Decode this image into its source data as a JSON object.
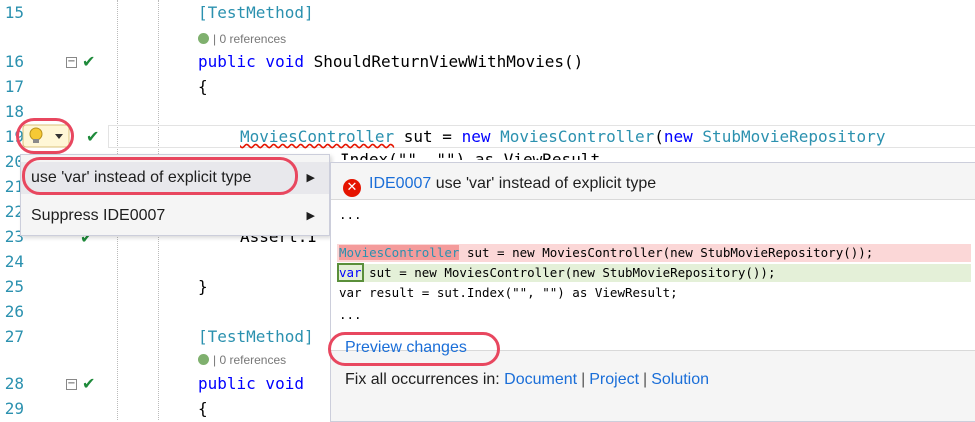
{
  "editor": {
    "lines": [
      {
        "num": "15",
        "text": "[TestMethod]"
      },
      {
        "num": "16",
        "text": "public void ShouldReturnViewWithMovies()"
      },
      {
        "num": "17",
        "text": "{"
      },
      {
        "num": "18",
        "text": ""
      },
      {
        "num": "19",
        "text": "MoviesController sut = new MoviesController(new StubMovieRepository"
      },
      {
        "num": "20",
        "text": ""
      },
      {
        "num": "21",
        "text": ""
      },
      {
        "num": "22",
        "text": ""
      },
      {
        "num": "23",
        "text": "Assert.I"
      },
      {
        "num": "24",
        "text": ""
      },
      {
        "num": "25",
        "text": "}"
      },
      {
        "num": "26",
        "text": ""
      },
      {
        "num": "27",
        "text": "[TestMethod]"
      },
      {
        "num": "28",
        "text": "public void"
      },
      {
        "num": "29",
        "text": "{"
      }
    ],
    "codelens_1": "| 0 references",
    "codelens_2": "| 0 references",
    "partial_line_20": "Index(\"\", \"\") as ViewResult"
  },
  "quick_actions_menu": {
    "items": [
      {
        "label": "use 'var' instead of explicit type",
        "has_submenu": true,
        "selected": true
      },
      {
        "label": "Suppress IDE0007",
        "has_submenu": true,
        "selected": false
      }
    ]
  },
  "preview": {
    "diagnostic_id": "IDE0007",
    "diagnostic_message": "use 'var' instead of explicit type",
    "ellipsis_top": "...",
    "removed_token": "MoviesController",
    "removed_rest": " sut = new MoviesController(new StubMovieRepository());",
    "added_token": "var",
    "added_rest": " sut = new MoviesController(new StubMovieRepository());",
    "context_line": "var result = sut.Index(\"\", \"\") as ViewResult;",
    "ellipsis_bottom": "...",
    "preview_changes_label": "Preview changes",
    "fix_all_label": "Fix all occurrences in:",
    "fix_all_scopes": [
      "Document",
      "Project",
      "Solution"
    ]
  },
  "colors": {
    "error": "#e51400",
    "link": "#1a6ed8",
    "annotation": "#e8475f"
  }
}
